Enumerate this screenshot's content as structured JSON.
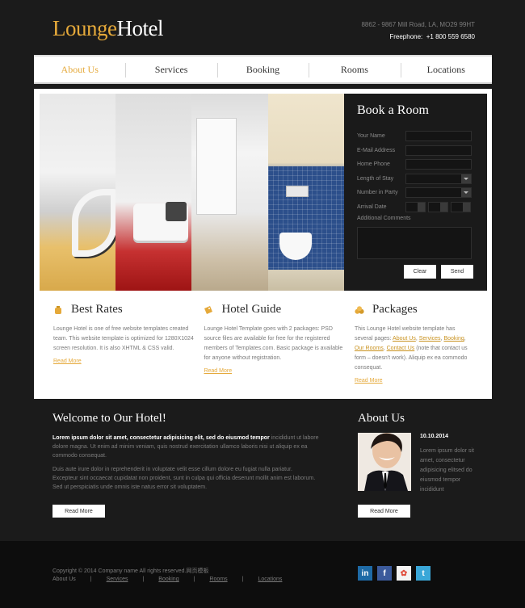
{
  "header": {
    "logo_part1": "Lounge",
    "logo_part2": "Hotel",
    "address": "8862 - 9867 Mill Road, LA, MO29 99HT",
    "freephone_label": "Freephone:",
    "freephone_number": "+1 800 559 6580"
  },
  "nav": {
    "items": [
      "About Us",
      "Services",
      "Booking",
      "Rooms",
      "Locations"
    ],
    "active_index": 0
  },
  "booking": {
    "title": "Book a Room",
    "fields": {
      "name": "Your Name",
      "email": "E-Mail Address",
      "phone": "Home Phone",
      "stay": "Length of Stay",
      "party": "Number in Party",
      "date": "Arrival Date",
      "comments": "Additional Comments"
    },
    "clear_label": "Clear",
    "send_label": "Send"
  },
  "features": [
    {
      "title": "Best Rates",
      "text": "Lounge Hotel is one of free website templates created team. This website template is optimized for 1280X1024 screen resolution. It is also XHTML & CSS valid.",
      "more": "Read More"
    },
    {
      "title": "Hotel Guide",
      "text": "Lounge Hotel Template goes with 2 packages: PSD source files are available for free for the registered members of Templates.com. Basic package is available for anyone without registration.",
      "more": "Read More"
    },
    {
      "title": "Packages",
      "text_start": "This Lounge Hotel website template has several pages:",
      "link1": "About Us",
      "link2": "Services",
      "link3": "Booking",
      "link4": "Our Rooms",
      "link5": "Contact Us",
      "text_end": "(note that contact us form – doesn't work). Aliquip ex ea commodo consequat.",
      "more": "Read More"
    }
  ],
  "welcome": {
    "title": "Welcome to Our Hotel!",
    "lead_bold": "Lorem ipsum dolor sit amet, consectetur adipisicing elit, sed do eiusmod tempor",
    "lead_rest": "incididunt ut labore dolore magna. Ut enim ad minim veniam, quis nostrud exercitation ullamco laboris nisi ut aliquip ex ea commodo consequat.",
    "para2": "Duis aute irure dolor in reprehenderit in voluptate velit esse cillum dolore eu fugiat nulla pariatur. Excepteur sint occaecat cupidatat non proident, sunt in culpa qui officia deserunt mollit anim est laborum. Sed ut perspiciatis unde omnis iste natus error sit voluptatem.",
    "read_more": "Read More"
  },
  "about": {
    "title": "About Us",
    "date": "10.10.2014",
    "text": "Lorem ipsum dolor sit amet, consectetur adipisicing elitsed do eiusmod tempor incididunt",
    "read_more": "Read More"
  },
  "footer": {
    "copyright": "Copyright © 2014 Company name All rights reserved.网页模板",
    "links": [
      "About Us",
      "Services",
      "Booking",
      "Rooms",
      "Locations"
    ],
    "separator": "|",
    "social": [
      "in",
      "f",
      "✿",
      "t"
    ]
  },
  "colors": {
    "accent": "#e5a93a",
    "background": "#1b1b1b",
    "panel": "#ffffff",
    "footer": "#0d0d0d"
  }
}
